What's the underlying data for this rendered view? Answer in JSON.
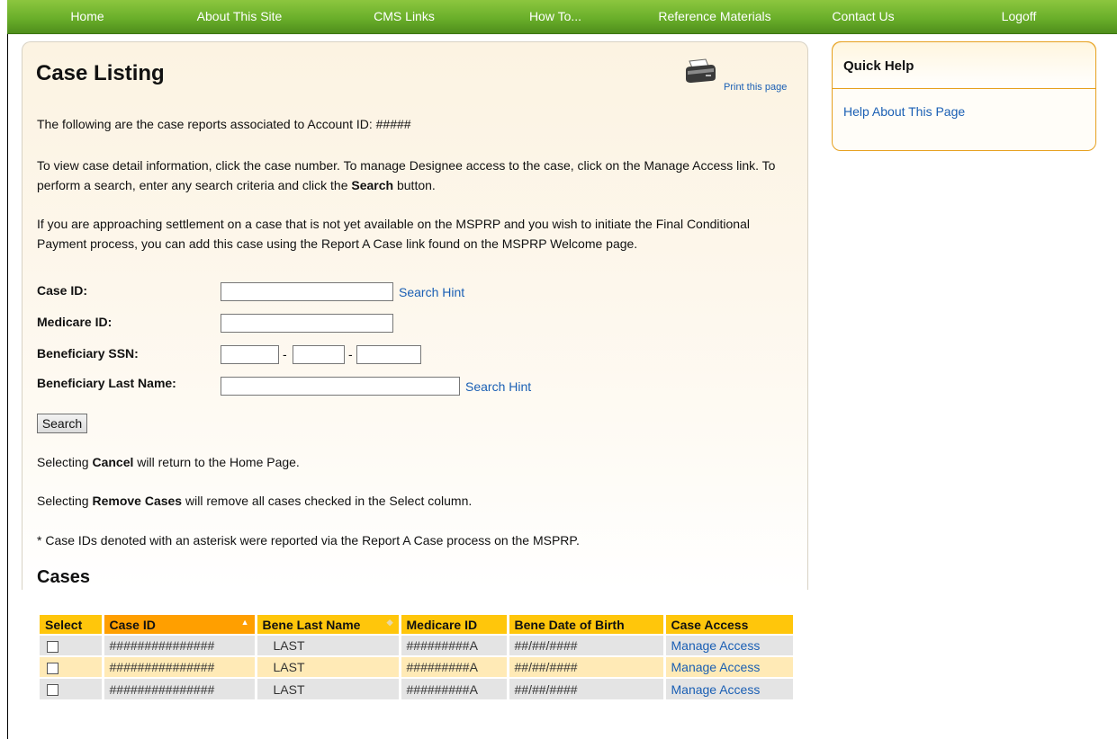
{
  "nav": {
    "items": [
      "Home",
      "About This Site",
      "CMS Links",
      "How To...",
      "Reference Materials",
      "Contact Us",
      "Logoff"
    ]
  },
  "header": {
    "title": "Case Listing",
    "print_link": "Print this page",
    "print_icon": "printer-icon"
  },
  "intro": {
    "account_text": "The following are the case reports associated to Account ID: #####",
    "instructions_before": "To view case detail information, click the case number. To manage Designee access to the case, click on the Manage Access link. To perform a search, enter any search criteria and click the ",
    "instructions_bold": "Search",
    "instructions_after": " button.",
    "settlement_text": "If you are approaching settlement on a case that is not yet available on the MSPRP and you wish to initiate the Final Conditional Payment process, you can add this case using the Report A Case link found on the MSPRP Welcome page."
  },
  "search_form": {
    "case_id_label": "Case ID:",
    "case_id_value": "",
    "medicare_id_label": "Medicare ID:",
    "medicare_id_value": "",
    "ssn_label": "Beneficiary SSN:",
    "ssn_sep": "-",
    "last_name_label": "Beneficiary Last Name:",
    "last_name_value": "",
    "search_hint": "Search Hint",
    "search_button": "Search"
  },
  "notes": {
    "cancel_pre": "Selecting ",
    "cancel_bold": "Cancel",
    "cancel_post": " will return to the Home Page.",
    "remove_pre": "Selecting ",
    "remove_bold": "Remove Cases",
    "remove_post": " will remove all cases checked in the Select column.",
    "asterisk": "* Case IDs denoted with an asterisk were reported via the Report A Case process on the MSPRP."
  },
  "cases": {
    "title": "Cases",
    "columns": [
      "Select",
      "Case ID",
      "Bene Last Name",
      "Medicare ID",
      "Bene Date of Birth",
      "Case Access"
    ],
    "rows": [
      {
        "case_id": "###############",
        "last_name": "LAST",
        "medicare_id": "#########A",
        "dob": "##/##/####",
        "access": "Manage Access"
      },
      {
        "case_id": "###############",
        "last_name": "LAST",
        "medicare_id": "#########A",
        "dob": "##/##/####",
        "access": "Manage Access"
      },
      {
        "case_id": "###############",
        "last_name": "LAST",
        "medicare_id": "#########A",
        "dob": "##/##/####",
        "access": "Manage Access"
      }
    ]
  },
  "quick_help": {
    "title": "Quick Help",
    "link": "Help About This Page"
  },
  "colors": {
    "nav_green": "#6aaf2a",
    "table_header": "#ffc60b",
    "table_header_sorted": "#ff9f00",
    "link_blue": "#1a5fb4"
  }
}
